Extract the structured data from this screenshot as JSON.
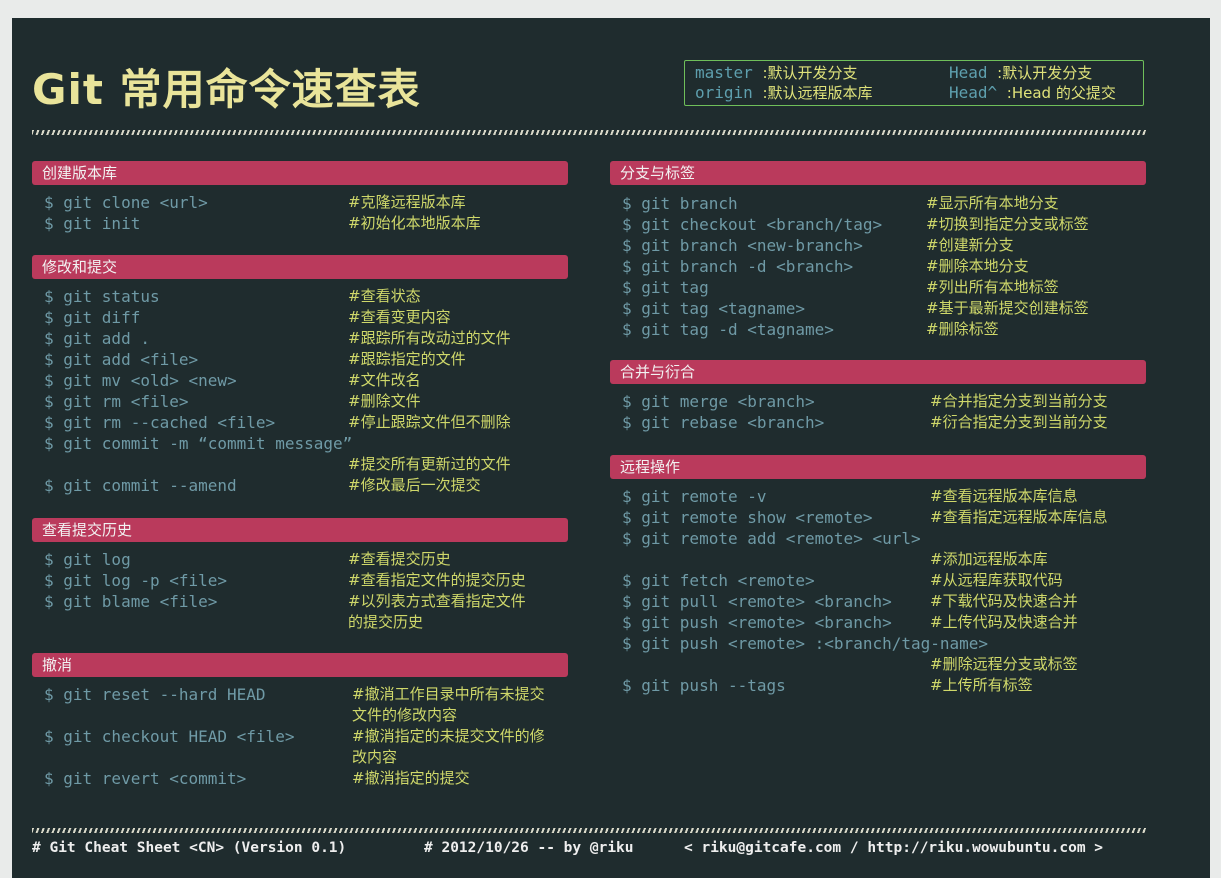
{
  "title": "Git 常用命令速查表",
  "legend": [
    {
      "key": "master ",
      "value": ":默认开发分支"
    },
    {
      "key": "origin ",
      "value": ":默认远程版本库"
    },
    {
      "key": "Head  ",
      "value": ":默认开发分支"
    },
    {
      "key": "Head^ ",
      "value": ":Head 的父提交"
    }
  ],
  "sections": {
    "create": {
      "title": "创建版本库",
      "rows": [
        {
          "cmd": "$ git clone <url>",
          "desc": "#克隆远程版本库"
        },
        {
          "cmd": "$ git init",
          "desc": "#初始化本地版本库"
        }
      ]
    },
    "modify": {
      "title": "修改和提交",
      "rows": [
        {
          "cmd": "$ git status",
          "desc": "#查看状态"
        },
        {
          "cmd": "$ git diff",
          "desc": "#查看变更内容"
        },
        {
          "cmd": "$ git add .",
          "desc": "#跟踪所有改动过的文件"
        },
        {
          "cmd": "$ git add <file>",
          "desc": "#跟踪指定的文件"
        },
        {
          "cmd": "$ git mv <old> <new>",
          "desc": "#文件改名"
        },
        {
          "cmd": "$ git rm <file>",
          "desc": "#删除文件"
        },
        {
          "cmd": "$ git rm --cached <file>",
          "desc": "#停止跟踪文件但不删除"
        },
        {
          "cmd": "$ git commit -m “commit message”",
          "desc": ""
        },
        {
          "cmd": "",
          "desc": "#提交所有更新过的文件"
        },
        {
          "cmd": "$ git commit --amend",
          "desc": "#修改最后一次提交"
        }
      ]
    },
    "history": {
      "title": "查看提交历史",
      "rows": [
        {
          "cmd": "$ git log",
          "desc": "#查看提交历史"
        },
        {
          "cmd": "$ git log -p <file>",
          "desc": "#查看指定文件的提交历史"
        },
        {
          "cmd": "$ git blame <file>",
          "desc": "#以列表方式查看指定文件"
        },
        {
          "cmd": "",
          "desc": "的提交历史"
        }
      ]
    },
    "undo": {
      "title": "撤消",
      "rows": [
        {
          "cmd": "$ git reset --hard HEAD",
          "desc": "#撤消工作目录中所有未提交"
        },
        {
          "cmd": "",
          "desc": "文件的修改内容"
        },
        {
          "cmd": "$ git checkout HEAD <file>",
          "desc": "#撤消指定的未提交文件的修"
        },
        {
          "cmd": "",
          "desc": "改内容"
        },
        {
          "cmd": "$ git revert <commit>",
          "desc": "#撤消指定的提交"
        }
      ]
    },
    "branch": {
      "title": "分支与标签",
      "rows": [
        {
          "cmd": "$ git branch",
          "desc": "#显示所有本地分支"
        },
        {
          "cmd": "$ git checkout <branch/tag>",
          "desc": "#切换到指定分支或标签"
        },
        {
          "cmd": "$ git branch <new-branch>",
          "desc": "#创建新分支"
        },
        {
          "cmd": "$ git branch -d <branch>",
          "desc": "#删除本地分支"
        },
        {
          "cmd": "$ git tag",
          "desc": "#列出所有本地标签"
        },
        {
          "cmd": "$ git tag <tagname>",
          "desc": "#基于最新提交创建标签"
        },
        {
          "cmd": "$ git tag -d <tagname>",
          "desc": "#删除标签"
        }
      ]
    },
    "merge": {
      "title": "合并与衍合",
      "rows": [
        {
          "cmd": "$ git merge <branch>",
          "desc": "#合并指定分支到当前分支"
        },
        {
          "cmd": "$ git rebase <branch>",
          "desc": "#衍合指定分支到当前分支"
        }
      ]
    },
    "remote": {
      "title": "远程操作",
      "rows": [
        {
          "cmd": "$ git remote -v",
          "desc": "#查看远程版本库信息"
        },
        {
          "cmd": "$ git remote show <remote>",
          "desc": "#查看指定远程版本库信息"
        },
        {
          "cmd": "$ git remote add <remote> <url>",
          "desc": ""
        },
        {
          "cmd": "",
          "desc": "#添加远程版本库"
        },
        {
          "cmd": "$ git fetch <remote>",
          "desc": "#从远程库获取代码"
        },
        {
          "cmd": "$ git pull <remote> <branch>",
          "desc": "#下载代码及快速合并"
        },
        {
          "cmd": "$ git push <remote> <branch>",
          "desc": "#上传代码及快速合并"
        },
        {
          "cmd": "$ git push <remote> :<branch/tag-name>",
          "desc": ""
        },
        {
          "cmd": "",
          "desc": "#删除远程分支或标签"
        },
        {
          "cmd": "$ git push --tags",
          "desc": "#上传所有标签"
        }
      ]
    }
  },
  "footer": {
    "left": "# Git Cheat Sheet <CN> (Version 0.1)",
    "middle": "# 2012/10/26  -- by @riku",
    "right": "< riku@gitcafe.com / http://riku.wowubuntu.com >"
  },
  "colors": {
    "background": "#1f2c2e",
    "header_bar": "#ba3a5c",
    "command": "#6f9aa6",
    "description": "#cfd86a",
    "title": "#e9e49a"
  }
}
